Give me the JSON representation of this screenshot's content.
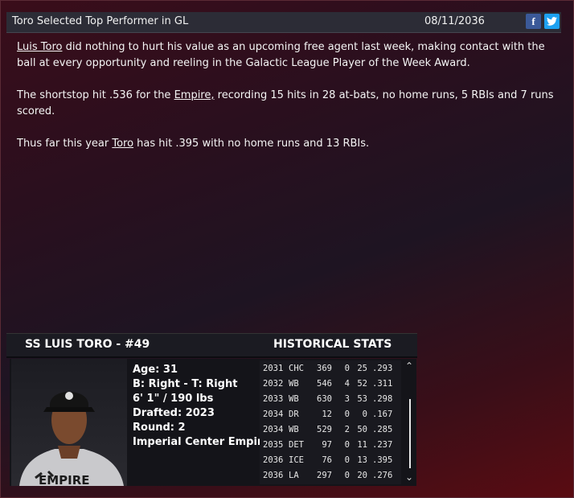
{
  "header": {
    "title": "Toro Selected Top Performer in GL",
    "date": "08/11/2036",
    "facebook_icon": "f",
    "twitter_icon": "twitter-bird"
  },
  "article": {
    "p1_link": "Luis Toro",
    "p1_text": " did nothing to hurt his value as an upcoming free agent last week, making contact with the ball at every opportunity and reeling in the Galactic League Player of the Week Award.",
    "p2_pre": "The shortstop hit .536 for the ",
    "p2_link": "Empire,",
    "p2_text": " recording 15 hits in 28 at-bats, no home runs, 5 RBIs and 7 runs scored.",
    "p3_pre": "Thus far this year ",
    "p3_link": "Toro",
    "p3_text": " has hit .395 with no home runs and 13 RBIs."
  },
  "player": {
    "heading": "SS LUIS TORO - #49",
    "age": "Age: 31",
    "bats_throws": "B: Right - T: Right",
    "height_weight": "6' 1\" / 190 lbs",
    "drafted": "Drafted: 2023",
    "round": "Round: 2",
    "team": "Imperial Center Empire",
    "jersey_text": "EMPIRE"
  },
  "historical": {
    "heading": "HISTORICAL STATS",
    "rows": [
      {
        "year": "2031",
        "team": "CHC",
        "ab": "369",
        "hr": "0",
        "rbi": "25",
        "avg": ".293"
      },
      {
        "year": "2032",
        "team": "WB",
        "ab": "546",
        "hr": "4",
        "rbi": "52",
        "avg": ".311"
      },
      {
        "year": "2033",
        "team": "WB",
        "ab": "630",
        "hr": "3",
        "rbi": "53",
        "avg": ".298"
      },
      {
        "year": "2034",
        "team": "DR",
        "ab": "12",
        "hr": "0",
        "rbi": "0",
        "avg": ".167"
      },
      {
        "year": "2034",
        "team": "WB",
        "ab": "529",
        "hr": "2",
        "rbi": "50",
        "avg": ".285"
      },
      {
        "year": "2035",
        "team": "DET",
        "ab": "97",
        "hr": "0",
        "rbi": "11",
        "avg": ".237"
      },
      {
        "year": "2036",
        "team": "ICE",
        "ab": "76",
        "hr": "0",
        "rbi": "13",
        "avg": ".395"
      },
      {
        "year": "2036",
        "team": "LA",
        "ab": "297",
        "hr": "0",
        "rbi": "20",
        "avg": ".276"
      }
    ]
  }
}
